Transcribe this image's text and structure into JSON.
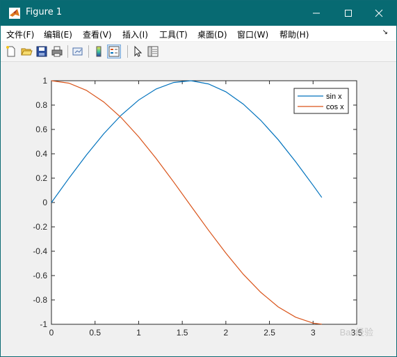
{
  "window": {
    "title": "Figure 1",
    "accent_color": "#076a72",
    "controls": [
      "minimize-icon",
      "maximize-icon",
      "close-icon"
    ]
  },
  "menu": [
    {
      "label": "文件(F)"
    },
    {
      "label": "编辑(E)"
    },
    {
      "label": "查看(V)"
    },
    {
      "label": "插入(I)"
    },
    {
      "label": "工具(T)"
    },
    {
      "label": "桌面(D)"
    },
    {
      "label": "窗口(W)"
    },
    {
      "label": "帮助(H)"
    }
  ],
  "menu_overflow": "↘",
  "toolbar": [
    "new-figure-icon",
    "open-file-icon",
    "save-icon",
    "print-icon",
    "link-plot-icon",
    "colorbar-icon",
    "legend-icon",
    "pointer-icon",
    "property-editor-icon"
  ],
  "chart_data": {
    "type": "line",
    "title": "",
    "xlabel": "",
    "ylabel": "",
    "xlim": [
      0,
      3.5
    ],
    "ylim": [
      -1,
      1
    ],
    "xticks": [
      "0",
      "0.5",
      "1",
      "1.5",
      "2",
      "2.5",
      "3",
      "3.5"
    ],
    "yticks": [
      "1",
      "0.8",
      "0.6",
      "0.4",
      "0.2",
      "0",
      "-0.2",
      "-0.4",
      "-0.6",
      "-0.8",
      "-1"
    ],
    "grid": false,
    "legend_position": "top-right",
    "x": [
      0,
      0.2,
      0.4,
      0.6,
      0.8,
      1.0,
      1.2,
      1.4,
      1.6,
      1.8,
      2.0,
      2.2,
      2.4,
      2.6,
      2.8,
      3.0,
      3.1
    ],
    "series": [
      {
        "name": "sin x",
        "color": "#0072bd",
        "values": [
          0,
          0.199,
          0.389,
          0.565,
          0.717,
          0.841,
          0.932,
          0.985,
          1.0,
          0.974,
          0.909,
          0.808,
          0.675,
          0.516,
          0.335,
          0.141,
          0.042
        ]
      },
      {
        "name": "cos x",
        "color": "#d95319",
        "values": [
          1.0,
          0.98,
          0.921,
          0.825,
          0.697,
          0.54,
          0.362,
          0.17,
          -0.029,
          -0.227,
          -0.416,
          -0.589,
          -0.737,
          -0.857,
          -0.942,
          -0.99,
          -0.999
        ]
      }
    ]
  },
  "watermark": "Bai 经验"
}
